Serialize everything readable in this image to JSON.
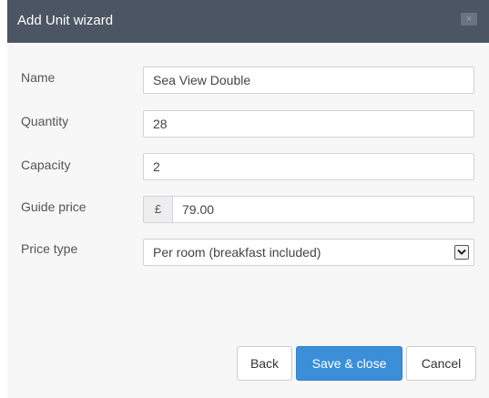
{
  "dialog": {
    "title": "Add Unit wizard",
    "close_label": "×"
  },
  "fields": {
    "name": {
      "label": "Name",
      "value": "Sea View Double"
    },
    "quantity": {
      "label": "Quantity",
      "value": "28"
    },
    "capacity": {
      "label": "Capacity",
      "value": "2"
    },
    "guide_price": {
      "label": "Guide price",
      "currency_symbol": "£",
      "value": "79.00"
    },
    "price_type": {
      "label": "Price type",
      "selected": "Per room (breakfast included)"
    }
  },
  "buttons": {
    "back": "Back",
    "save_close": "Save & close",
    "cancel": "Cancel"
  },
  "colors": {
    "titlebar": "#4b5563",
    "primary": "#3b8ed8",
    "body_background": "#f7f7f7"
  }
}
